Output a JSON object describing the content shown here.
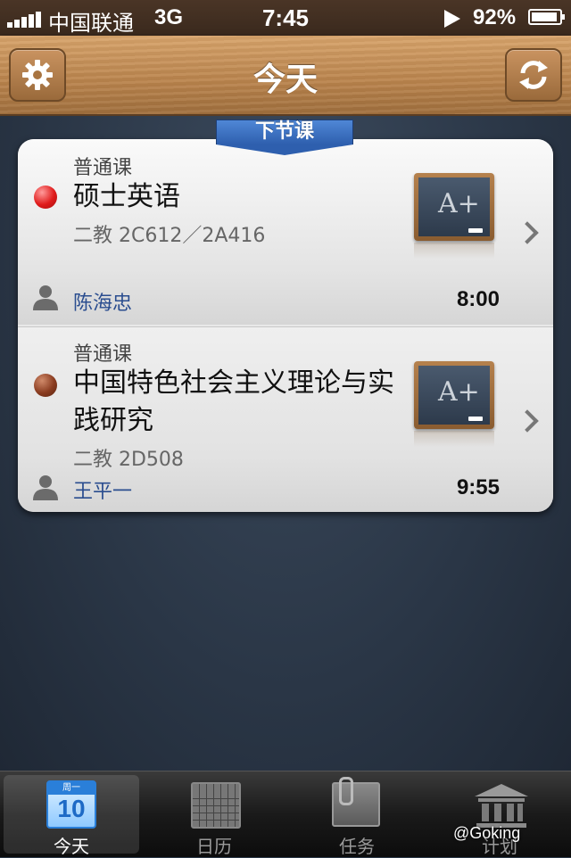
{
  "status_bar": {
    "carrier": "中国联通",
    "network": "3G",
    "time": "7:45",
    "battery": "92%",
    "battery_level": 0.92
  },
  "header": {
    "title": "今天",
    "left_icon": "gear-icon",
    "right_icon": "refresh-icon"
  },
  "next_class_tag": "下节课",
  "classes": [
    {
      "type": "普通课",
      "name": "硕士英语",
      "location": "二教 2C612／2A416",
      "teacher": "陈海忠",
      "time": "8:00",
      "dot_color": "#e01b1b"
    },
    {
      "type": "普通课",
      "name": "中国特色社会主义理论与实践研究",
      "location": "二教 2D508",
      "teacher": "王平一",
      "time": "9:55",
      "dot_color": "#8a3c20"
    }
  ],
  "chalkboard_text": "A+",
  "tabbar": {
    "tabs": [
      {
        "label": "今天",
        "icon": "calendar-day-icon",
        "cal_top": "周一",
        "cal_num": "10",
        "active": true
      },
      {
        "label": "日历",
        "icon": "calendar-grid-icon",
        "active": false
      },
      {
        "label": "任务",
        "icon": "task-clip-icon",
        "active": false
      },
      {
        "label": "计划",
        "icon": "building-icon",
        "active": false
      }
    ]
  },
  "watermark": "@Goking"
}
